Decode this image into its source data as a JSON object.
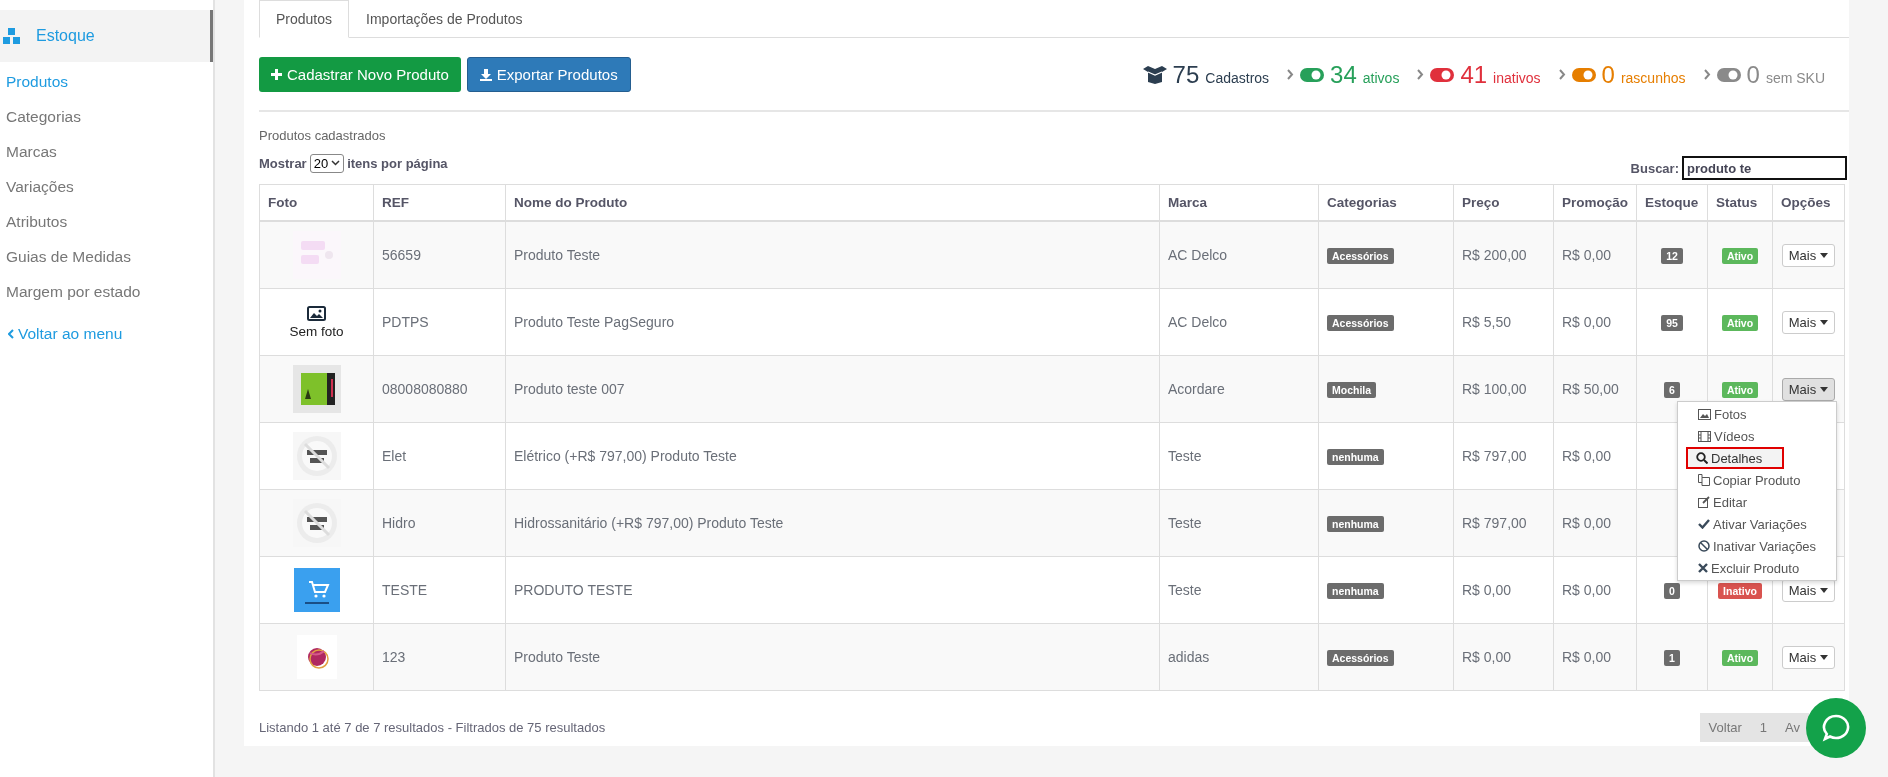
{
  "sidebar": {
    "header": "Estoque",
    "items": [
      {
        "label": "Produtos",
        "selected": true
      },
      {
        "label": "Categorias",
        "selected": false
      },
      {
        "label": "Marcas",
        "selected": false
      },
      {
        "label": "Variações",
        "selected": false
      },
      {
        "label": "Atributos",
        "selected": false
      },
      {
        "label": "Guias de Medidas",
        "selected": false
      },
      {
        "label": "Margem por estado",
        "selected": false
      }
    ],
    "back_link": "Voltar ao menu"
  },
  "tabs": [
    {
      "label": "Produtos",
      "selected": true
    },
    {
      "label": "Importações de Produtos",
      "selected": false
    }
  ],
  "buttons": [
    {
      "label": "Cadastrar Novo Produto",
      "kind": "add"
    },
    {
      "label": "Exportar Produtos",
      "kind": "export"
    }
  ],
  "stats": [
    {
      "kind": "box",
      "count": "75",
      "label": "Cadastros",
      "color": "#2c3e50"
    },
    {
      "kind": "toggle",
      "count": "34",
      "label": "ativos",
      "color": "#27a05a"
    },
    {
      "kind": "toggle",
      "count": "41",
      "label": "inativos",
      "color": "#e0303c"
    },
    {
      "kind": "toggle",
      "count": "0",
      "label": "rascunhos",
      "color": "#e67e00"
    },
    {
      "kind": "toggle",
      "count": "0",
      "label": "sem SKU",
      "color": "#8a8a8a"
    }
  ],
  "section_title": "Produtos cadastrados",
  "page_size": {
    "before": "Mostrar",
    "value": "20",
    "after": "itens por página"
  },
  "search": {
    "label": "Buscar:",
    "value": "produto te"
  },
  "table": {
    "columns": [
      "Foto",
      "REF",
      "Nome do Produto",
      "Marca",
      "Categorias",
      "Preço",
      "Promoção",
      "Estoque",
      "Status",
      "Opções"
    ],
    "rows": [
      {
        "ref": "56659",
        "name": "Produto Teste",
        "brand": "AC Delco",
        "category": "Acessórios",
        "price": "R$ 200,00",
        "promo": "R$ 0,00",
        "stock": "12",
        "status": {
          "label": "Ativo",
          "active": true
        },
        "options": "Mais"
      },
      {
        "photo": {
          "kind": "none",
          "text": "Sem foto"
        },
        "ref": "PDTPS",
        "name": "Produto Teste PagSeguro",
        "brand": "AC Delco",
        "category": "Acessórios",
        "price": "R$ 5,50",
        "promo": "R$ 0,00",
        "stock": "95",
        "status": {
          "label": "Ativo",
          "active": true
        },
        "options": "Mais"
      },
      {
        "ref": "08008080880",
        "name": "Produto teste 007",
        "brand": "Acordare",
        "category": "Mochila",
        "price": "R$ 100,00",
        "promo": "R$ 50,00",
        "stock": "6",
        "status": {
          "label": "Ativo",
          "active": true
        },
        "options": "Mais",
        "menu_open": true
      },
      {
        "ref": "Elet",
        "name": "Elétrico (+R$ 797,00) Produto Teste",
        "brand": "Teste",
        "category": "nenhuma",
        "price": "R$ 797,00",
        "promo": "R$ 0,00"
      },
      {
        "ref": "Hidro",
        "name": "Hidrossanitário (+R$ 797,00) Produto Teste",
        "brand": "Teste",
        "category": "nenhuma",
        "price": "R$ 797,00",
        "promo": "R$ 0,00"
      },
      {
        "ref": "TESTE",
        "name": "PRODUTO TESTE",
        "brand": "Teste",
        "category": "nenhuma",
        "price": "R$ 0,00",
        "promo": "R$ 0,00",
        "stock": "0",
        "status": {
          "label": "Inativo",
          "active": false
        },
        "options": "Mais"
      },
      {
        "ref": "123",
        "name": "Produto Teste",
        "brand": "adidas",
        "category": "Acessórios",
        "price": "R$ 0,00",
        "promo": "R$ 0,00",
        "stock": "1",
        "status": {
          "label": "Ativo",
          "active": true
        },
        "options": "Mais"
      }
    ]
  },
  "options_menu": [
    {
      "kind": "photos",
      "label": "Fotos",
      "highlighted": false
    },
    {
      "kind": "videos",
      "label": "Vídeos",
      "highlighted": false
    },
    {
      "kind": "details",
      "label": "Detalhes",
      "highlighted": true
    },
    {
      "kind": "copy",
      "label": "Copiar Produto",
      "highlighted": false
    },
    {
      "kind": "edit",
      "label": "Editar",
      "highlighted": false
    },
    {
      "kind": "enable",
      "label": "Ativar Variações",
      "highlighted": false
    },
    {
      "kind": "disable",
      "label": "Inativar Variações",
      "highlighted": false
    },
    {
      "kind": "delete",
      "label": "Excluir Produto",
      "highlighted": false
    }
  ],
  "footer": {
    "summary": "Listando 1 até 7 de 7 resultados - Filtrados de 75 resultados",
    "pagination": [
      "Voltar",
      "1",
      "Av"
    ]
  }
}
